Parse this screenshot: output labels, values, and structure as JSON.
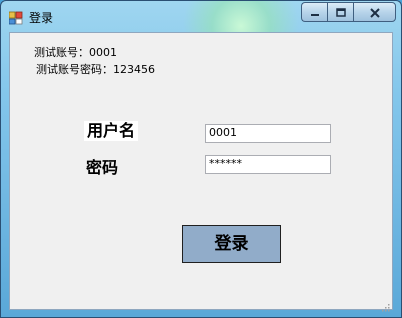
{
  "window": {
    "title": "登录",
    "icon": "app-window-icon",
    "caption_buttons": [
      "minimize-icon",
      "maximize-icon",
      "close-icon"
    ]
  },
  "info": {
    "line1": "测试账号：0001",
    "line2": "测试账号密码：123456"
  },
  "form": {
    "username_label": "用户名",
    "username_value": "0001",
    "password_label": "密码",
    "password_value": "******"
  },
  "buttons": {
    "login": "登录"
  },
  "colors": {
    "client_background": "#f0f0f0",
    "login_button": "#91acc9",
    "titlebar_glass": "#83c6eb"
  }
}
